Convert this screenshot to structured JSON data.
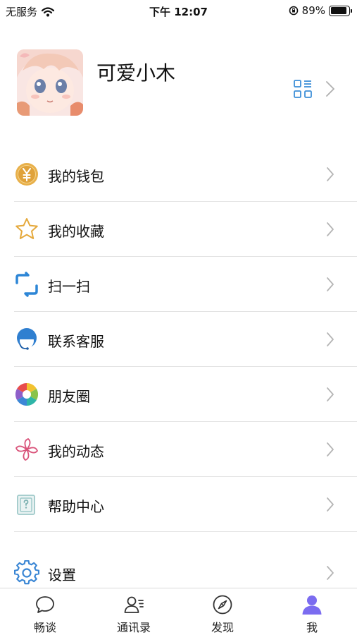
{
  "status_bar": {
    "carrier": "无服务",
    "time": "下午 12:07",
    "battery_percent": "89%",
    "battery_level": 0.89
  },
  "profile": {
    "name": "可爱小木"
  },
  "menu": [
    {
      "label": "我的钱包",
      "icon": "wallet-yen-icon"
    },
    {
      "label": "我的收藏",
      "icon": "star-icon"
    },
    {
      "label": "扫一扫",
      "icon": "scan-icon"
    },
    {
      "label": "联系客服",
      "icon": "customer-service-icon"
    },
    {
      "label": "朋友圈",
      "icon": "moments-aperture-icon"
    },
    {
      "label": "我的动态",
      "icon": "pinwheel-icon"
    },
    {
      "label": "帮助中心",
      "icon": "help-center-icon"
    },
    {
      "label": "设置",
      "icon": "gear-icon"
    }
  ],
  "tabs": [
    {
      "label": "畅谈",
      "icon": "chat-bubble-icon"
    },
    {
      "label": "通讯录",
      "icon": "contacts-icon"
    },
    {
      "label": "发现",
      "icon": "compass-icon"
    },
    {
      "label": "我",
      "icon": "person-icon",
      "active": true
    }
  ],
  "colors": {
    "accent": "#7b6cf0",
    "icon_blue": "#2d86d6",
    "coin": "#e0a53a"
  }
}
